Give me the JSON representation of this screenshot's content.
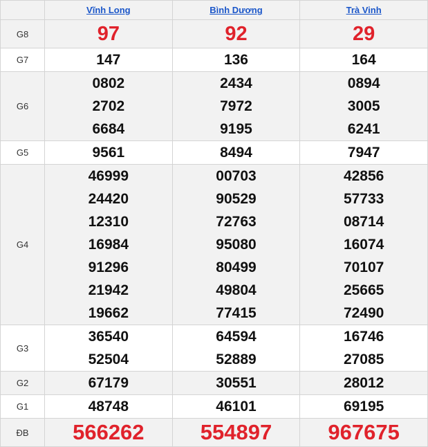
{
  "provinces": [
    "Vĩnh Long",
    "Bình Dương",
    "Trà Vinh"
  ],
  "prizes": [
    {
      "label": "G8",
      "values": [
        [
          "97"
        ],
        [
          "92"
        ],
        [
          "29"
        ]
      ]
    },
    {
      "label": "G7",
      "values": [
        [
          "147"
        ],
        [
          "136"
        ],
        [
          "164"
        ]
      ]
    },
    {
      "label": "G6",
      "values": [
        [
          "0802",
          "2702",
          "6684"
        ],
        [
          "2434",
          "7972",
          "9195"
        ],
        [
          "0894",
          "3005",
          "6241"
        ]
      ]
    },
    {
      "label": "G5",
      "values": [
        [
          "9561"
        ],
        [
          "8494"
        ],
        [
          "7947"
        ]
      ]
    },
    {
      "label": "G4",
      "values": [
        [
          "46999",
          "24420",
          "12310",
          "16984",
          "91296",
          "21942",
          "19662"
        ],
        [
          "00703",
          "90529",
          "72763",
          "95080",
          "80499",
          "49804",
          "77415"
        ],
        [
          "42856",
          "57733",
          "08714",
          "16074",
          "70107",
          "25665",
          "72490"
        ]
      ]
    },
    {
      "label": "G3",
      "values": [
        [
          "36540",
          "52504"
        ],
        [
          "64594",
          "52889"
        ],
        [
          "16746",
          "27085"
        ]
      ]
    },
    {
      "label": "G2",
      "values": [
        [
          "67179"
        ],
        [
          "30551"
        ],
        [
          "28012"
        ]
      ]
    },
    {
      "label": "G1",
      "values": [
        [
          "48748"
        ],
        [
          "46101"
        ],
        [
          "69195"
        ]
      ]
    },
    {
      "label": "ĐB",
      "values": [
        [
          "566262"
        ],
        [
          "554897"
        ],
        [
          "967675"
        ]
      ]
    }
  ],
  "colors": {
    "highlight": "#e0222b",
    "link": "#1a56c9",
    "alt_row": "#f2f2f2"
  }
}
